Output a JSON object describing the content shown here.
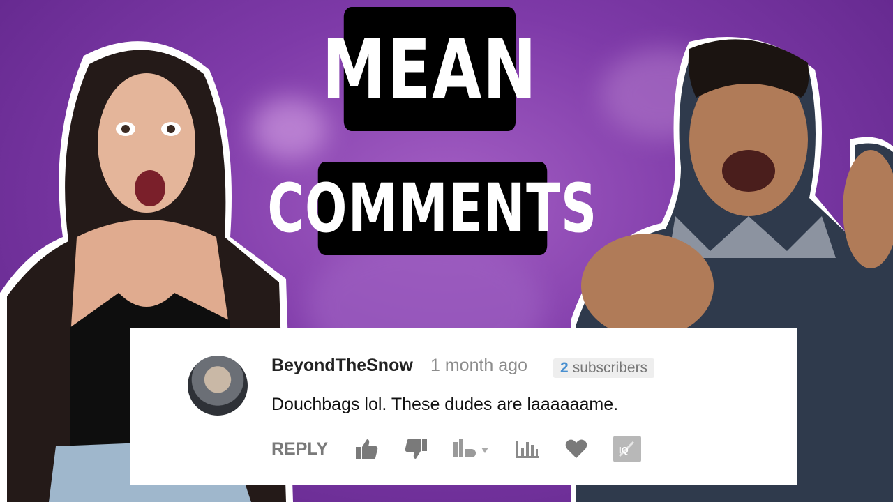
{
  "title": {
    "line1": "MEAN",
    "line2": "COMMENTS"
  },
  "comment": {
    "username": "BeyondTheSnow",
    "time": "1 month ago",
    "subscriber_count": "2",
    "subscriber_label": "subscribers",
    "text": "Douchbags lol. These dudes are laaaaaame.",
    "reply_label": "REPLY"
  },
  "icons": [
    "thumbs-up-icon",
    "thumbs-down-icon",
    "tubebuddy-icon",
    "stats-icon",
    "heart-icon",
    "iq-icon"
  ],
  "colors": {
    "background": "#7e3aa8",
    "title_bg": "#000000",
    "card_bg": "#ffffff",
    "badge_number": "#4a90d0"
  }
}
